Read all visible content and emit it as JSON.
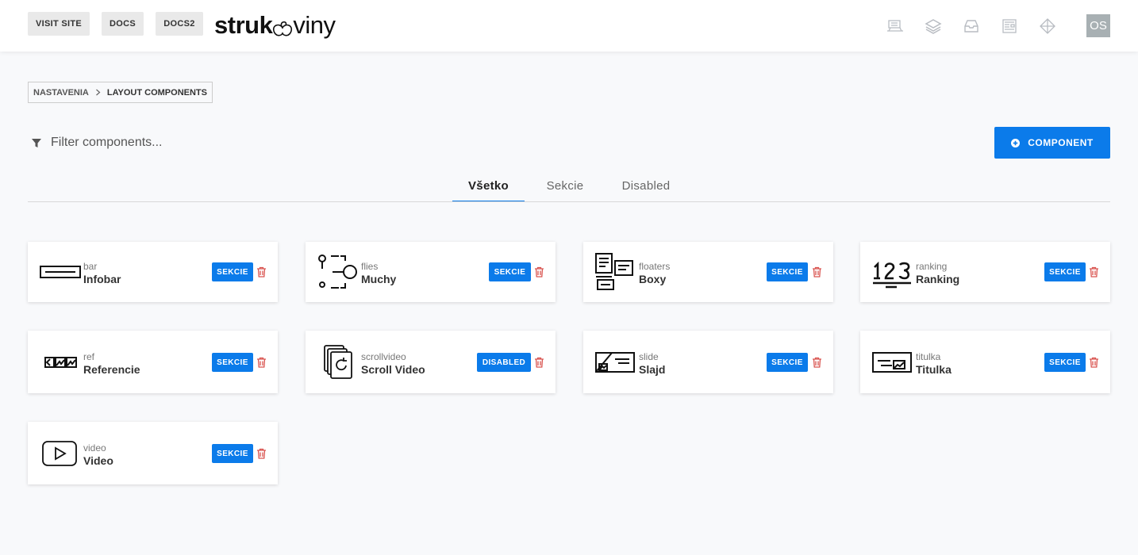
{
  "header": {
    "buttons": [
      "VISIT SITE",
      "DOCS",
      "DOCS2"
    ],
    "logo": {
      "part1": "struk",
      "part2": "viny"
    },
    "icons": [
      "keyboard-icon",
      "layers-icon",
      "inbox-icon",
      "news-icon",
      "diamond-icon"
    ],
    "avatar": "OS"
  },
  "breadcrumb": {
    "items": [
      "NASTAVENIA",
      "LAYOUT COMPONENTS"
    ]
  },
  "filter": {
    "placeholder": "Filter components..."
  },
  "add_button": {
    "label": "COMPONENT"
  },
  "tabs": [
    {
      "label": "Všetko",
      "active": true
    },
    {
      "label": "Sekcie",
      "active": false
    },
    {
      "label": "Disabled",
      "active": false
    }
  ],
  "components": [
    {
      "key": "bar",
      "name": "Infobar",
      "status": "SEKCIE",
      "icon": "infobar-icon"
    },
    {
      "key": "flies",
      "name": "Muchy",
      "status": "SEKCIE",
      "icon": "flies-icon"
    },
    {
      "key": "floaters",
      "name": "Boxy",
      "status": "SEKCIE",
      "icon": "floaters-icon"
    },
    {
      "key": "ranking",
      "name": "Ranking",
      "status": "SEKCIE",
      "icon": "ranking-icon"
    },
    {
      "key": "ref",
      "name": "Referencie",
      "status": "SEKCIE",
      "icon": "references-icon"
    },
    {
      "key": "scrollvideo",
      "name": "Scroll Video",
      "status": "DISABLED",
      "icon": "scroll-video-icon"
    },
    {
      "key": "slide",
      "name": "Slajd",
      "status": "SEKCIE",
      "icon": "slide-icon"
    },
    {
      "key": "titulka",
      "name": "Titulka",
      "status": "SEKCIE",
      "icon": "title-page-icon"
    },
    {
      "key": "video",
      "name": "Video",
      "status": "SEKCIE",
      "icon": "video-icon"
    }
  ],
  "colors": {
    "accent": "#0b7bea",
    "danger": "#d9534f",
    "avatar_bg": "#a8b0b3"
  }
}
